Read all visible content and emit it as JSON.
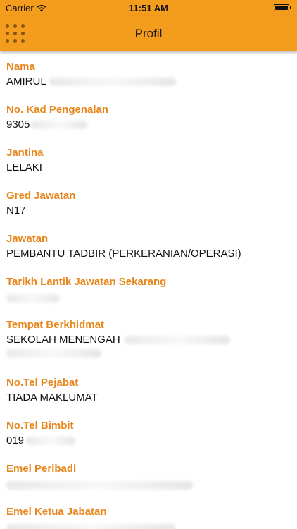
{
  "status_bar": {
    "carrier": "Carrier",
    "time": "11:51 AM"
  },
  "nav": {
    "title": "Profil",
    "menu_icon": "grid-dots-icon"
  },
  "colors": {
    "accent": "#f39c1e",
    "label": "#e8861c"
  },
  "profile": {
    "fields": [
      {
        "label": "Nama",
        "value": "AMIRUL"
      },
      {
        "label": "No. Kad Pengenalan",
        "value": "9305"
      },
      {
        "label": "Jantina",
        "value": "LELAKI"
      },
      {
        "label": "Gred Jawatan",
        "value": "N17"
      },
      {
        "label": "Jawatan",
        "value": "PEMBANTU TADBIR (PERKERANIAN/OPERASI)"
      },
      {
        "label": "Tarikh Lantik Jawatan Sekarang",
        "value": ""
      },
      {
        "label": "Tempat Berkhidmat",
        "value": "SEKOLAH MENENGAH"
      },
      {
        "label": "No.Tel Pejabat",
        "value": "TIADA MAKLUMAT"
      },
      {
        "label": "No.Tel Bimbit",
        "value": "019"
      },
      {
        "label": "Emel Peribadi",
        "value": ""
      },
      {
        "label": "Emel Ketua Jabatan",
        "value": ""
      }
    ]
  }
}
